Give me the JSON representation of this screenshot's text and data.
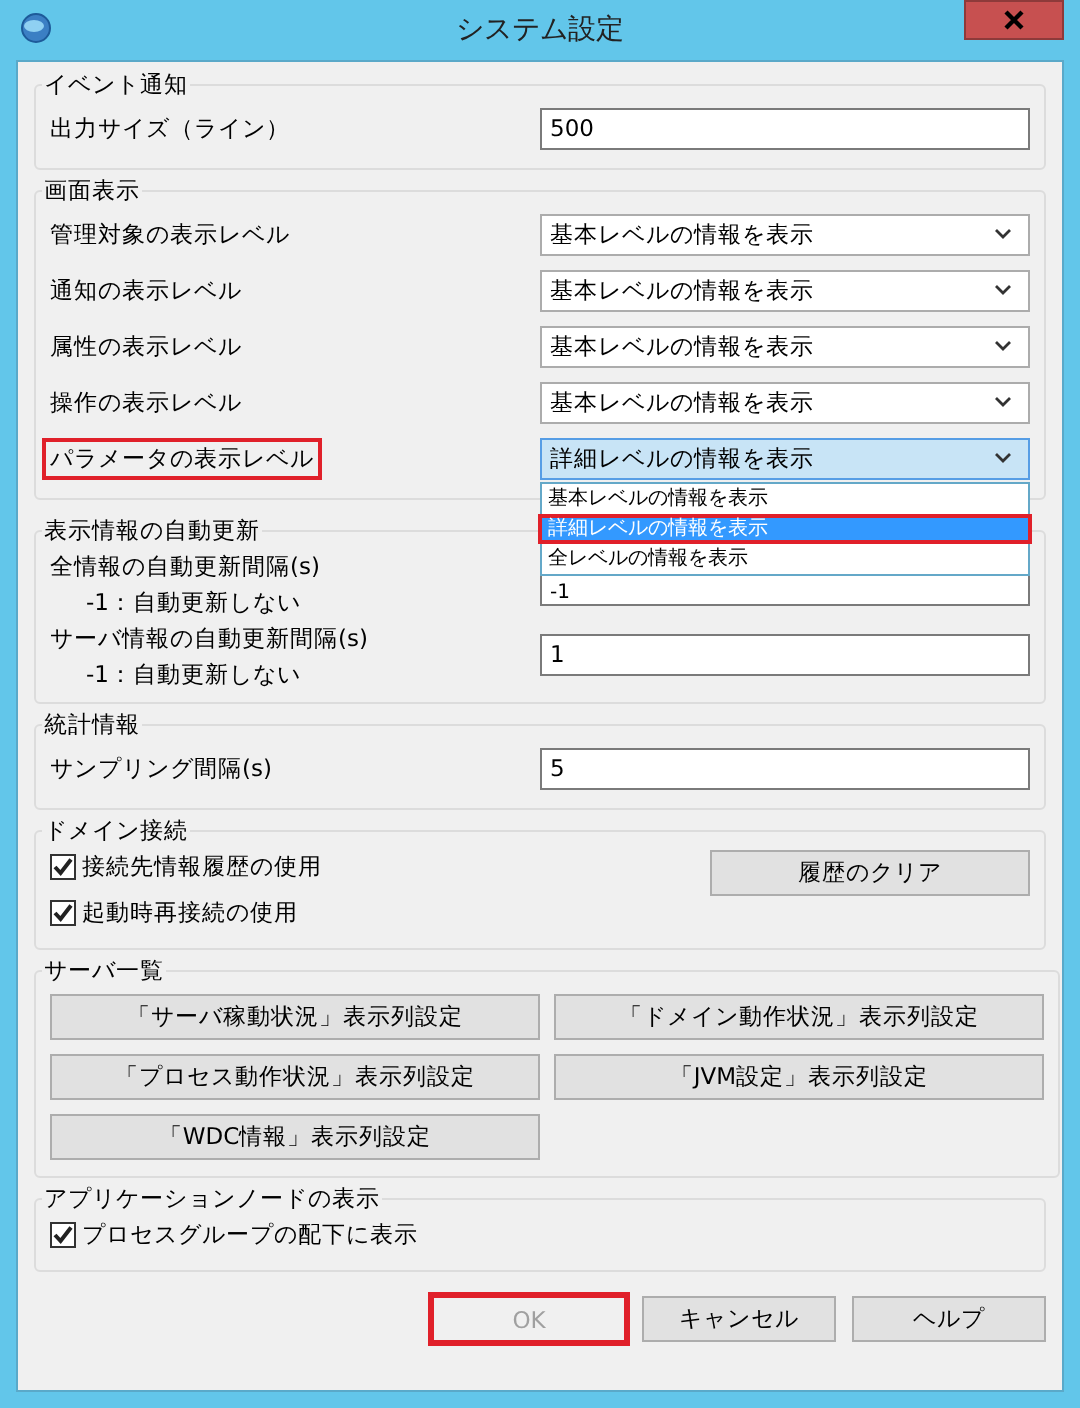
{
  "window": {
    "title": "システム設定"
  },
  "sections": [
    {
      "kind": "form",
      "title": "イベント通知",
      "rows": [
        {
          "kind": "input",
          "label": "出力サイズ（ライン）",
          "value": "500",
          "highlighted": false
        }
      ]
    },
    {
      "kind": "form",
      "title": "画面表示",
      "rows": [
        {
          "kind": "select",
          "label": "管理対象の表示レベル",
          "value": "基本レベルの情報を表示",
          "highlighted": false,
          "expanded": false
        },
        {
          "kind": "select",
          "label": "通知の表示レベル",
          "value": "基本レベルの情報を表示",
          "highlighted": false,
          "expanded": false
        },
        {
          "kind": "select",
          "label": "属性の表示レベル",
          "value": "基本レベルの情報を表示",
          "highlighted": false,
          "expanded": false
        },
        {
          "kind": "select",
          "label": "操作の表示レベル",
          "value": "基本レベルの情報を表示",
          "highlighted": false,
          "expanded": false
        },
        {
          "kind": "select",
          "label": "パラメータの表示レベル",
          "value": "詳細レベルの情報を表示",
          "highlighted": true,
          "expanded": true,
          "options": [
            {
              "label": "基本レベルの情報を表示",
              "selected": false,
              "highlighted": false
            },
            {
              "label": "詳細レベルの情報を表示",
              "selected": true,
              "highlighted": true
            },
            {
              "label": "全レベルの情報を表示",
              "selected": false,
              "highlighted": false
            }
          ]
        }
      ]
    },
    {
      "kind": "form",
      "title": "表示情報の自動更新",
      "rows": [
        {
          "kind": "input",
          "label": "全情報の自動更新間隔(s)",
          "note": "-1：自動更新しない",
          "value": "-1",
          "highlighted": false
        },
        {
          "kind": "input",
          "label": "サーバ情報の自動更新間隔(s)",
          "note": "-1：自動更新しない",
          "value": "1",
          "highlighted": false
        }
      ]
    },
    {
      "kind": "form",
      "title": "統計情報",
      "rows": [
        {
          "kind": "input",
          "label": "サンプリング間隔(s)",
          "value": "5",
          "highlighted": false
        }
      ]
    },
    {
      "kind": "domain",
      "title": "ドメイン接続",
      "checks": [
        {
          "label": "接続先情報履歴の使用",
          "checked": true
        },
        {
          "label": "起動時再接続の使用",
          "checked": true
        }
      ],
      "button": "履歴のクリア"
    },
    {
      "kind": "buttons",
      "title": "サーバ一覧",
      "buttons": [
        "「サーバ稼動状況」表示列設定",
        "「ドメイン動作状況」表示列設定",
        "「プロセス動作状況」表示列設定",
        "「JVM設定」表示列設定",
        "「WDC情報」表示列設定"
      ]
    },
    {
      "kind": "checks",
      "title": "アプリケーションノードの表示",
      "checks": [
        {
          "label": "プロセスグループの配下に表示",
          "checked": true
        }
      ]
    }
  ],
  "buttons": [
    {
      "label": "OK",
      "disabled": true,
      "highlighted": true
    },
    {
      "label": "キャンセル",
      "disabled": false,
      "highlighted": false
    },
    {
      "label": "ヘルプ",
      "disabled": false,
      "highlighted": false
    }
  ]
}
